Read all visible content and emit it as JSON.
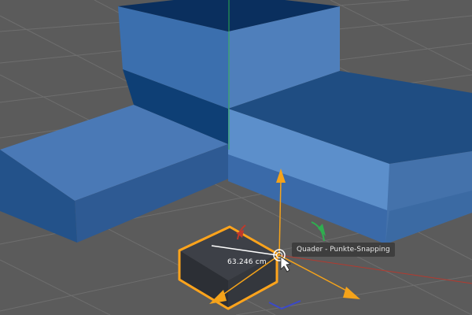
{
  "viewport": {
    "measurement": {
      "distance_label": "63.246 cm"
    },
    "tooltip": {
      "text": "Quader - Punkte-Snapping"
    },
    "colors": {
      "background": "#5a5a5a",
      "grid": "#6d6d6d",
      "object_top": "#4c7dbd",
      "object_front": "#2f5f9c",
      "object_dark": "#0f3d6e",
      "selection_outline": "#ffa41c",
      "gizmo_arrow": "#f5a31a",
      "axis_y": "#29a84a",
      "axis_x": "#c0392b",
      "axis_z": "#3b49c9",
      "tooltip_bg": "#3e3e3e"
    },
    "icons": [
      "snap-cursor-icon",
      "mouse-pointer-icon"
    ]
  }
}
